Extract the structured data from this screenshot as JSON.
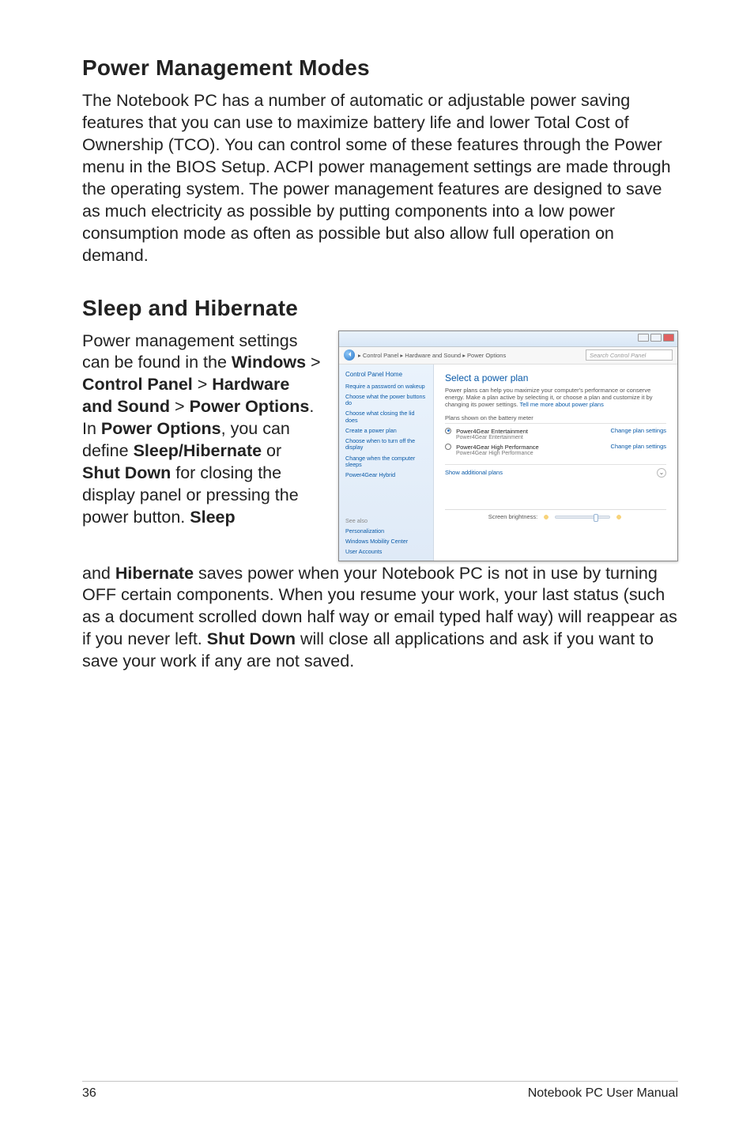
{
  "heading1": "Power Management Modes",
  "para1": "The Notebook PC has a number of automatic or adjustable power saving features that you can use to maximize battery life and lower Total Cost of Ownership (TCO). You can control some of these features through the Power menu in the BIOS Setup. ACPI power management settings are made through the operating system. The power management features are designed to save as much electricity as possible by putting components into a low power consumption mode as often as possible but also allow full operation on demand.",
  "heading2": "Sleep and Hibernate",
  "para2_seg1": "Power management settings can be found in the ",
  "para2_b1": "Windows",
  "para2_seg2": " > ",
  "para2_b2": "Control Panel",
  "para2_seg3": " > ",
  "para2_b3": "Hardware and Sound",
  "para2_seg4": " > ",
  "para2_b4": "Power Options",
  "para2_seg5": ". In ",
  "para2_b5": "Power Options",
  "para2_seg6": ", you can define ",
  "para2_b6": "Sleep/Hibernate",
  "para2_seg7": " or ",
  "para2_b7": "Shut Down",
  "para2_seg8": " for closing the display panel or pressing the power button. ",
  "para2_b8": "Sleep",
  "para3_seg1": "and ",
  "para3_b1": "Hibernate",
  "para3_seg2": " saves power when your Notebook PC is not in use by turning OFF certain components. When you resume your work, your last status (such as a document scrolled down half way or email typed half way) will reappear as if you never left. ",
  "para3_b2": "Shut Down",
  "para3_seg3": " will close all applications and ask if you want to save your work if any are not saved.",
  "footer_left": "36",
  "footer_right": "Notebook PC User Manual",
  "ss": {
    "breadcrumb": "▸ Control Panel ▸ Hardware and Sound ▸ Power Options",
    "search_placeholder": "Search Control Panel",
    "sidebar": {
      "home": "Control Panel Home",
      "l1": "Require a password on wakeup",
      "l2": "Choose what the power buttons do",
      "l3": "Choose what closing the lid does",
      "l4": "Create a power plan",
      "l5": "Choose when to turn off the display",
      "l6": "Change when the computer sleeps",
      "l7": "Power4Gear Hybrid",
      "seealso": "See also",
      "sa1": "Personalization",
      "sa2": "Windows Mobility Center",
      "sa3": "User Accounts"
    },
    "main_title": "Select a power plan",
    "main_desc1": "Power plans can help you maximize your computer's performance or conserve energy. Make a plan active by selecting it, or choose a plan and customize it by changing its power settings. ",
    "main_learn": "Tell me more about power plans",
    "group1": "Plans shown on the battery meter",
    "plan1": "Power4Gear Entertainment",
    "plan1_sub": "Power4Gear Entertainment",
    "plan2": "Power4Gear High Performance",
    "plan2_sub": "Power4Gear High Performance",
    "change": "Change plan settings",
    "showmore": "Show additional plans",
    "brightness": "Screen brightness:"
  }
}
